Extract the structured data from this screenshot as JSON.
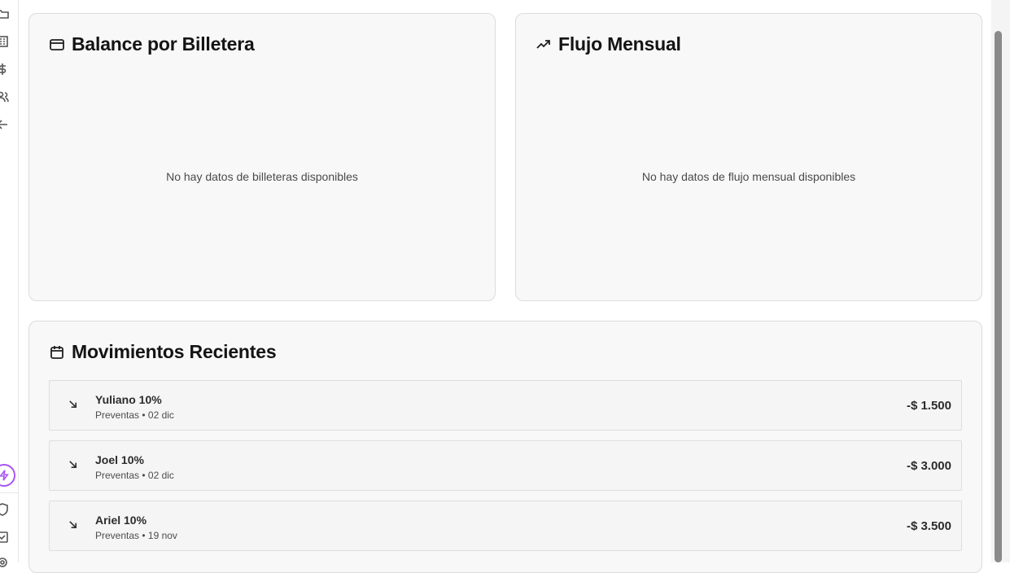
{
  "sidebar": {
    "icons": [
      "folder-icon",
      "building-icon",
      "dollar-icon",
      "users-icon",
      "arrow-left-icon",
      "bolt-icon",
      "shield-icon",
      "checkbox-icon",
      "settings-icon"
    ]
  },
  "balance_card": {
    "title": "Balance por Billetera",
    "icon": "credit-card-icon",
    "empty_text": "No hay datos de billeteras disponibles"
  },
  "flow_card": {
    "title": "Flujo Mensual",
    "icon": "trending-up-icon",
    "empty_text": "No hay datos de flujo mensual disponibles"
  },
  "movements": {
    "title": "Movimientos Recientes",
    "icon": "calendar-icon",
    "items": [
      {
        "title": "Yuliano 10%",
        "subtitle": "Preventas • 02 dic",
        "amount": "-$ 1.500"
      },
      {
        "title": "Joel 10%",
        "subtitle": "Preventas • 02 dic",
        "amount": "-$ 3.000"
      },
      {
        "title": "Ariel 10%",
        "subtitle": "Preventas • 19 nov",
        "amount": "-$ 3.500"
      }
    ]
  },
  "colors": {
    "accent": "#a855f7",
    "card_bg": "#f8f8f8",
    "border": "#dcdcdc"
  }
}
